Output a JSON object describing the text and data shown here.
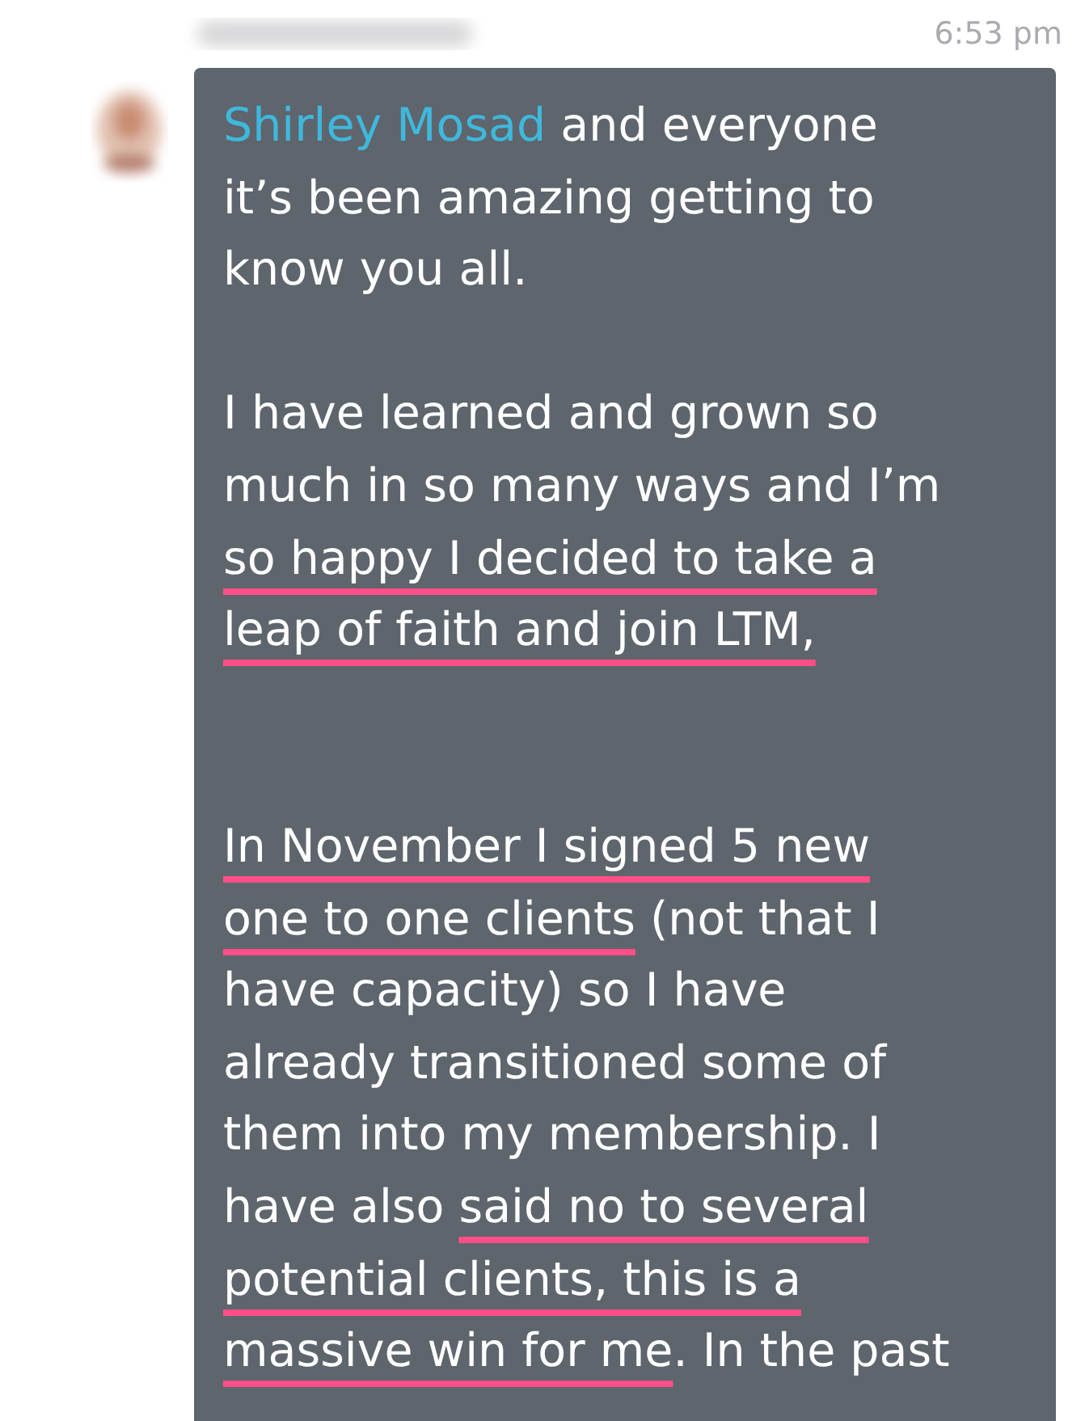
{
  "message": {
    "time": "6:53 pm",
    "paragraphs": [
      {
        "lines": [
          [
            {
              "text": "Shirley Mosad",
              "kind": "mention"
            },
            {
              "text": " and everyone"
            }
          ],
          [
            {
              "text": "it’s been amazing getting to"
            }
          ],
          [
            {
              "text": "know you all."
            }
          ]
        ]
      },
      {
        "lines": [
          [
            {
              "text": "I have learned and grown so"
            }
          ],
          [
            {
              "text": "much in so many ways and I’m"
            }
          ],
          [
            {
              "text": "so happy I decided to take a",
              "underlined": true
            }
          ],
          [
            {
              "text": "leap of faith and join LTM,",
              "underlined": true
            }
          ]
        ]
      },
      {
        "lines": [
          [
            {
              "text": "In November I signed 5 new",
              "underlined": true
            }
          ],
          [
            {
              "text": "one to one clients",
              "underlined": true
            },
            {
              "text": " (not that I"
            }
          ],
          [
            {
              "text": "have capacity) so I have"
            }
          ],
          [
            {
              "text": "already transitioned some of"
            }
          ],
          [
            {
              "text": "them into my membership. I"
            }
          ],
          [
            {
              "text": "have also "
            },
            {
              "text": "said no to several",
              "underlined": true
            }
          ],
          [
            {
              "text": "potential clients, this is a",
              "underlined": true
            }
          ],
          [
            {
              "text": "massive win for me",
              "underlined": true
            },
            {
              "text": ". In the past"
            }
          ]
        ]
      }
    ]
  }
}
